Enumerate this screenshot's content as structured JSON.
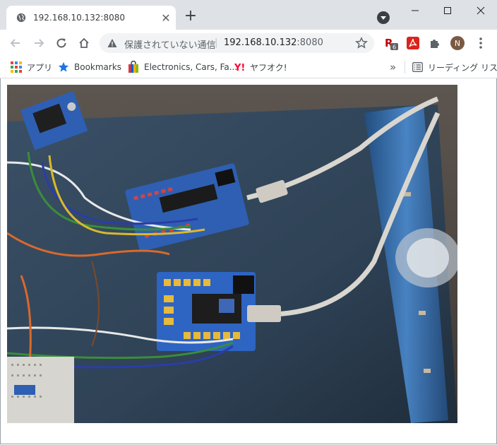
{
  "tab": {
    "title": "192.168.10.132:8080"
  },
  "address_bar": {
    "security_label": "保護されていない通信",
    "host": "192.168.10.132",
    "port": ":8080"
  },
  "extensions": {
    "badge_count": "6",
    "profile_initial": "N"
  },
  "bookmarks": {
    "items": [
      {
        "label": "アプリ",
        "icon": "apps-grid-icon"
      },
      {
        "label": "Bookmarks",
        "icon": "star-icon"
      },
      {
        "label": "Electronics, Cars, Fa...",
        "icon": "shopping-bag-icon"
      },
      {
        "label": "ヤフオク!",
        "icon": "yahoo-icon"
      }
    ],
    "overflow": "»",
    "reading_list": "リーディング リスト"
  },
  "colors": {
    "tabstrip": "#dee1e6",
    "omnibox": "#f1f3f4",
    "board_blue": "#2e5fb3",
    "mat": "#2f4256"
  }
}
